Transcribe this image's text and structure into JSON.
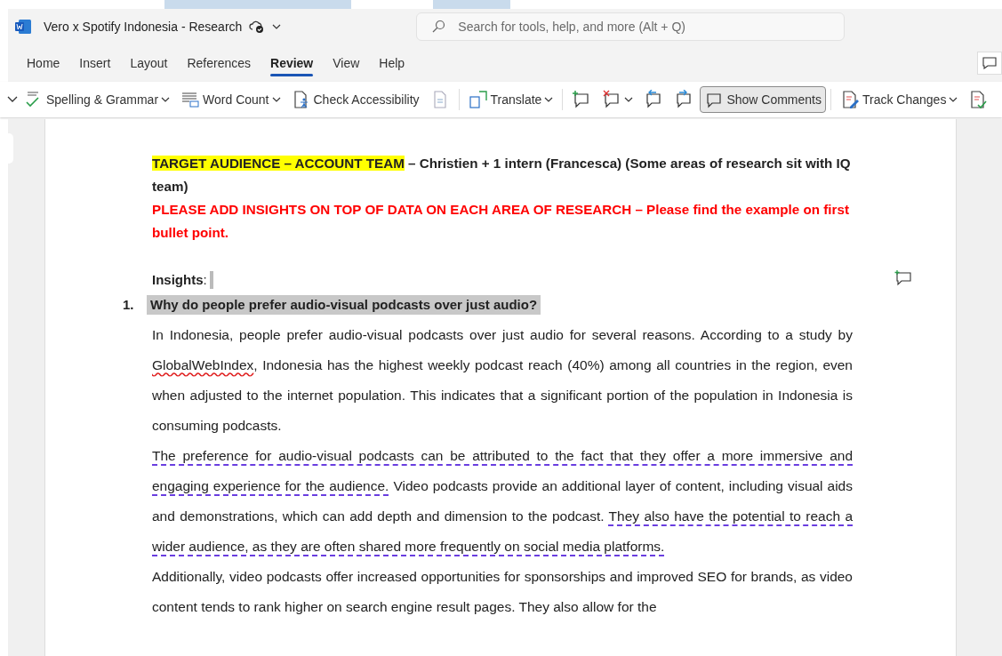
{
  "window": {
    "title": "Vero x Spotify Indonesia - Research"
  },
  "search": {
    "placeholder": "Search for tools, help, and more (Alt + Q)"
  },
  "tabs": [
    {
      "label": "Home",
      "selected": false
    },
    {
      "label": "Insert",
      "selected": false
    },
    {
      "label": "Layout",
      "selected": false
    },
    {
      "label": "References",
      "selected": false
    },
    {
      "label": "Review",
      "selected": true
    },
    {
      "label": "View",
      "selected": false
    },
    {
      "label": "Help",
      "selected": false
    }
  ],
  "toolbar": [
    {
      "kind": "spelling",
      "label": "Spelling & Grammar",
      "dropdown": true,
      "pressed": false
    },
    {
      "kind": "wordcount",
      "label": "Word Count",
      "dropdown": true,
      "pressed": false
    },
    {
      "kind": "accessibility",
      "label": "Check Accessibility",
      "dropdown": false,
      "pressed": false
    },
    {
      "kind": "doc",
      "dropdown": false,
      "pressed": false
    },
    {
      "kind": "separator"
    },
    {
      "kind": "translate",
      "label": "Translate",
      "dropdown": true,
      "pressed": false
    },
    {
      "kind": "separator"
    },
    {
      "kind": "newcomment",
      "dropdown": false,
      "pressed": false
    },
    {
      "kind": "deletecomment",
      "dropdown": true,
      "pressed": false
    },
    {
      "kind": "prevcomment",
      "dropdown": false,
      "pressed": false
    },
    {
      "kind": "nextcomment",
      "dropdown": false,
      "pressed": false
    },
    {
      "kind": "showcomments",
      "label": "Show Comments",
      "dropdown": false,
      "pressed": true
    },
    {
      "kind": "separator"
    },
    {
      "kind": "trackchanges",
      "label": "Track Changes",
      "dropdown": true,
      "pressed": false
    },
    {
      "kind": "accept",
      "dropdown": false,
      "pressed": false
    }
  ],
  "document": {
    "heading": [
      {
        "text": "TARGET AUDIENCE – ACCOUNT TEAM",
        "highlighted": true
      },
      {
        "text": " – Christien + 1 intern (Francesca) (Some areas of research sit with IQ team)"
      }
    ],
    "notice": "PLEASE ADD INSIGHTS ON TOP OF DATA ON EACH AREA OF RESEARCH – Please find the example on first bullet point.",
    "insights_label": "**Insights**:",
    "list": [
      {
        "number": "1.",
        "text": "Why do people prefer audio-visual podcasts over just audio?"
      }
    ],
    "paragraphs": [
      [
        {
          "text": "In Indonesia, people prefer audio-visual podcasts over just audio for several reasons. According to a study by "
        },
        {
          "text": "GlobalWebIndex",
          "spelling_error": true
        },
        {
          "text": ", Indonesia has the highest weekly podcast reach (40%) among all countries in the region, even when adjusted to the internet population. This indicates that a significant portion of the population in Indonesia is consuming podcasts."
        }
      ],
      [
        {
          "text": "The preference for audio-visual podcasts can be attributed to the fact that they offer a more immersive and engaging experience for the audience.",
          "grammar_flag": true
        },
        {
          "text": " Video podcasts provide an additional layer of content, including visual aids and demonstrations, which can add depth and dimension to the podcast. "
        },
        {
          "text": "They also have the potential to reach a wider audience, as they are often shared more frequently on social media platforms.",
          "grammar_flag": true
        }
      ],
      [
        {
          "text": "Additionally, video podcasts offer increased opportunities for sponsorships and improved SEO for brands, as video content tends to rank higher on search engine result pages. They also allow for the"
        }
      ]
    ]
  }
}
